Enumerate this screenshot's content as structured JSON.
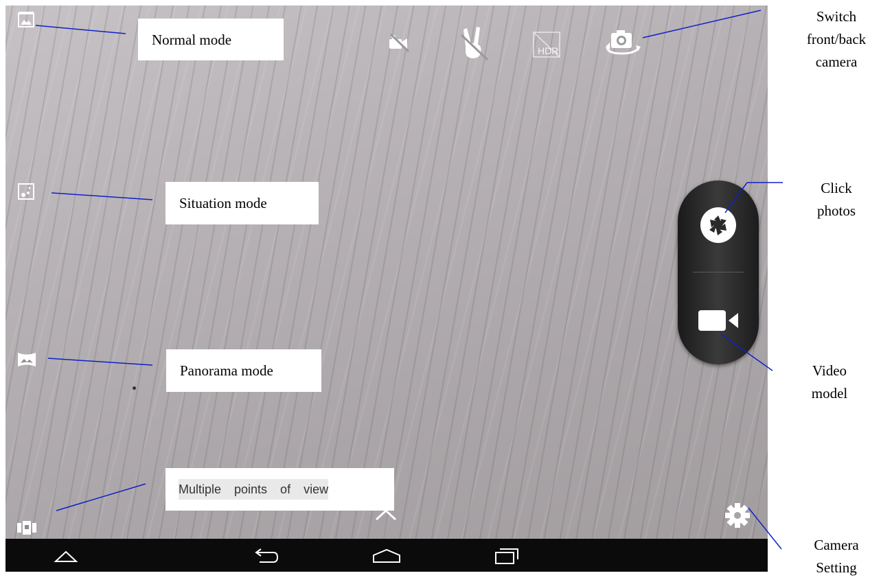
{
  "annotations": {
    "normal_mode": "Normal mode",
    "situation_mode": "Situation mode",
    "panorama_mode": "Panorama mode",
    "multiple_views": "Multiple points of view",
    "switch_camera": [
      "Switch",
      "front/back",
      "camera"
    ],
    "click_photos": [
      "Click",
      "photos"
    ],
    "video_model": [
      "Video",
      "model"
    ],
    "camera_setting": [
      "Camera",
      "Setting"
    ]
  },
  "left_mode_icons": [
    "normal-mode-icon",
    "situation-mode-icon",
    "panorama-mode-icon",
    "multiple-views-icon"
  ],
  "top_toolbar_icons": [
    "flash-off-icon",
    "gesture-off-icon",
    "hdr-off-icon",
    "switch-camera-icon"
  ],
  "shutter_controls": [
    "shutter-icon",
    "video-camera-icon"
  ],
  "settings_icon": "gear-icon",
  "nav_icons": [
    "recent-apps-up-icon",
    "back-icon",
    "home-icon",
    "recent-apps-icon"
  ],
  "colors": {
    "annotation_line": "#1020c8",
    "navbar": "#0b0b0b",
    "pill": "#2a2a2a"
  }
}
